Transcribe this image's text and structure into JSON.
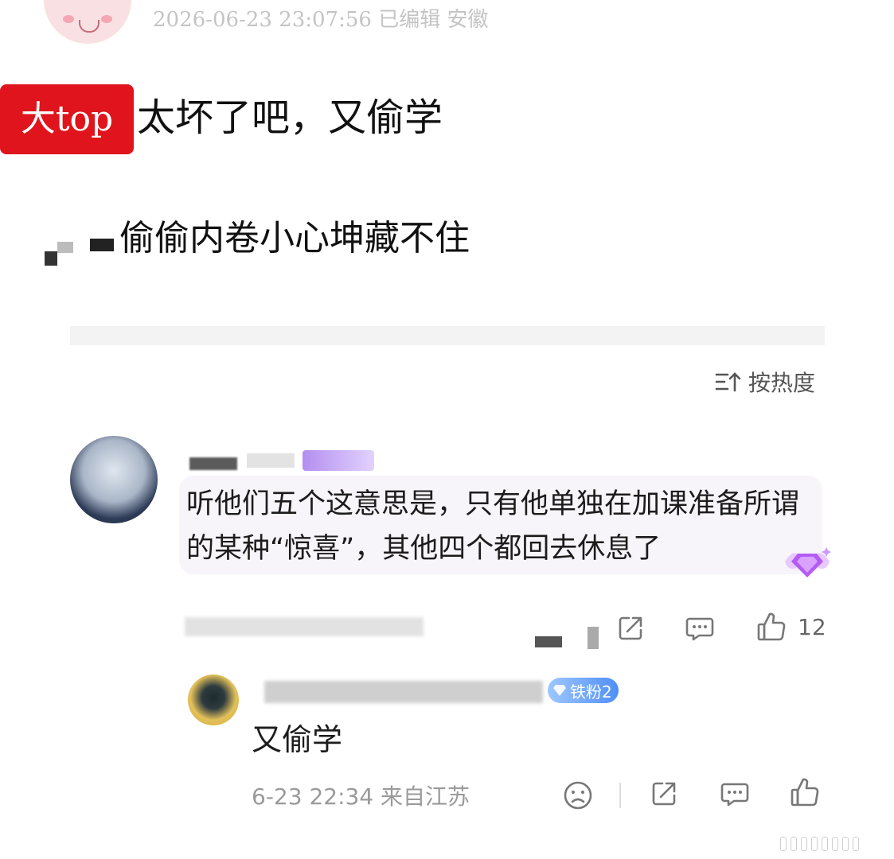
{
  "post": {
    "meta": "2026-06-23 23:07:56 已编辑 安徽",
    "tag": "大top",
    "line1": "太坏了吧，又偷学",
    "line2": "偷偷内卷小心坤藏不住"
  },
  "sort": {
    "label": "按热度",
    "icon": "sort-icon"
  },
  "comment": {
    "text": "听他们五个这意思是，只有他单独在加课准备所谓的某种“惊喜”，其他四个都回去休息了",
    "like_count": "12",
    "icons": [
      "share-icon",
      "comment-icon",
      "like-icon",
      "gem-icon"
    ]
  },
  "reply": {
    "badge": "铁粉2",
    "text": "又偷学",
    "meta": "6-23 22:34 来自江苏",
    "icons": [
      "sad-face-icon",
      "share-icon",
      "comment-icon",
      "like-icon"
    ]
  },
  "colors": {
    "tag_red": "#e0141c",
    "badge_blue": "#4f8ff7"
  }
}
